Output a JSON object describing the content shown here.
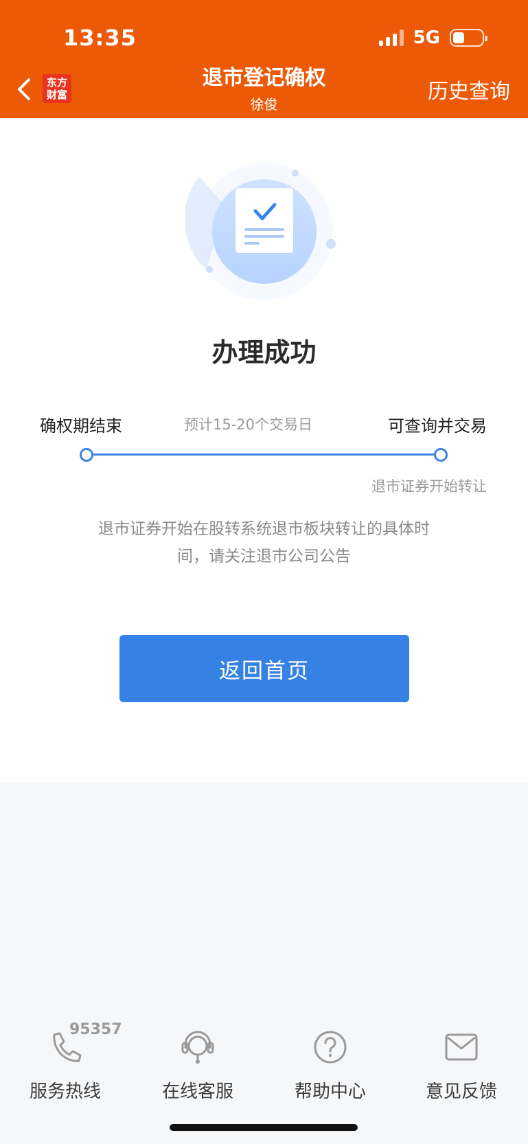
{
  "status_bar": {
    "time": "13:35",
    "network": "5G"
  },
  "header": {
    "logo_text_line1": "东方",
    "logo_text_line2": "财富",
    "title": "退市登记确权",
    "subtitle": "徐俊",
    "history_link": "历史查询",
    "background_color": "#ec5a07"
  },
  "result": {
    "title": "办理成功",
    "steps": {
      "start_label": "确权期结束",
      "middle_label": "预计15-20个交易日",
      "end_label": "可查询并交易",
      "end_note": "退市证券开始转让"
    },
    "description": "退市证券开始在股转系统退市板块转让的具体时间，请关注退市公司公告",
    "home_button": "返回首页",
    "accent_color": "#3682e4"
  },
  "bottom_nav": {
    "items": [
      {
        "label": "服务热线",
        "icon": "phone-icon",
        "badge": "95357"
      },
      {
        "label": "在线客服",
        "icon": "headset-icon"
      },
      {
        "label": "帮助中心",
        "icon": "question-icon"
      },
      {
        "label": "意见反馈",
        "icon": "mail-icon"
      }
    ]
  }
}
